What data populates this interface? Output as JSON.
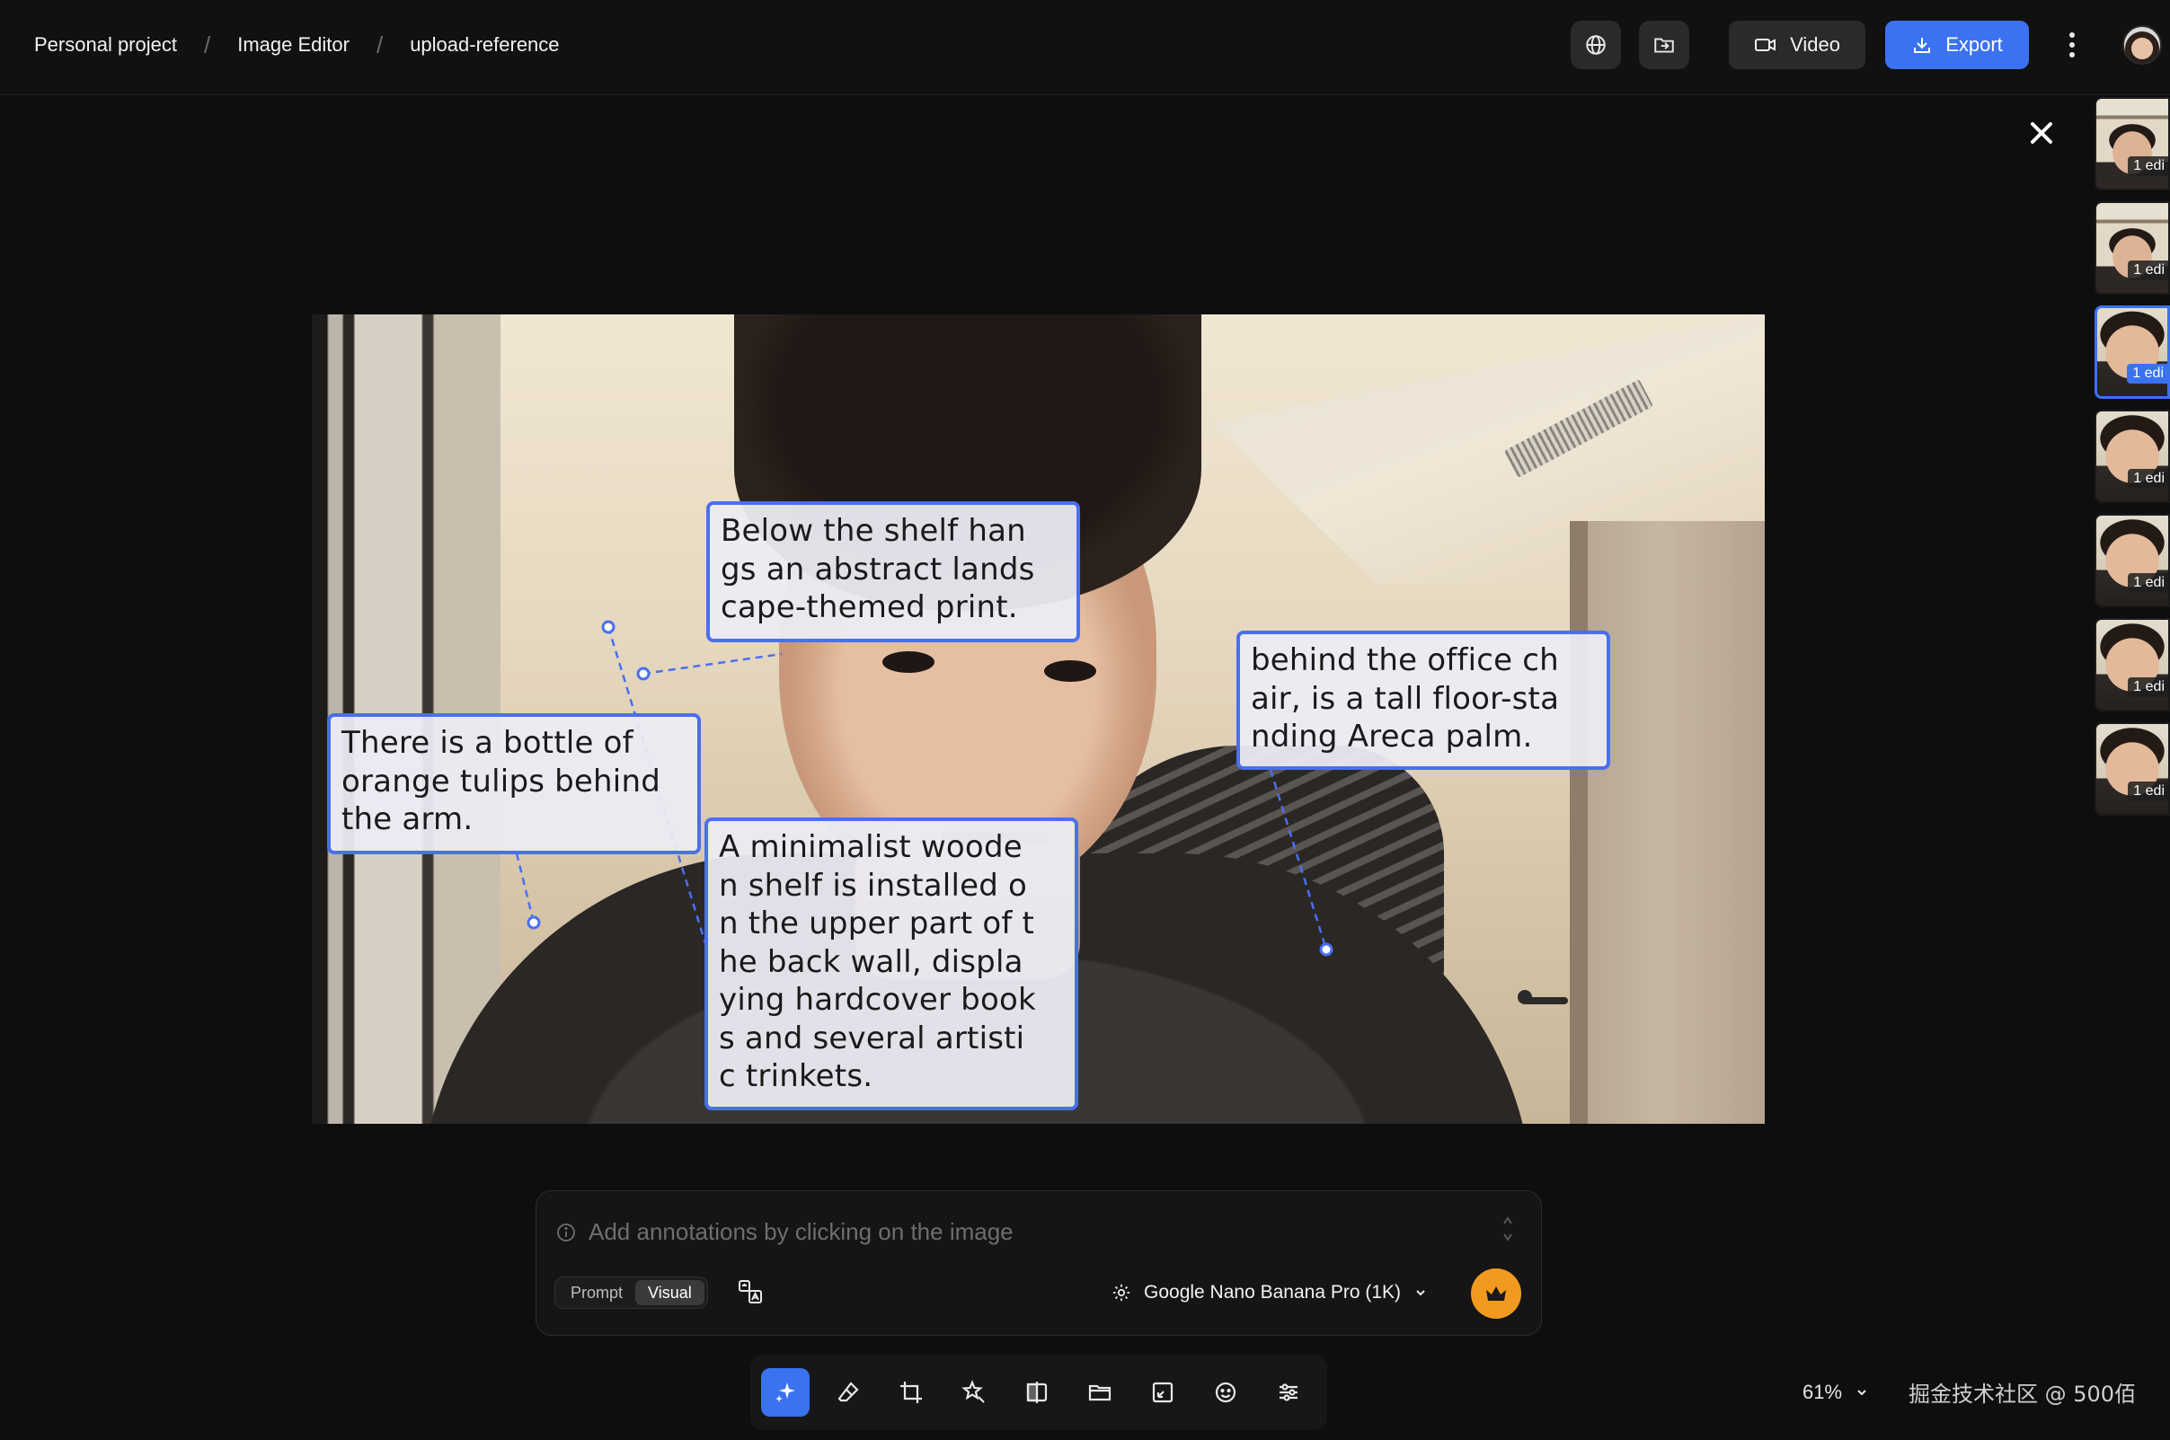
{
  "breadcrumb": [
    "Personal project",
    "Image Editor",
    "upload-reference"
  ],
  "breadcrumb_sep": "/",
  "header": {
    "video_label": "Video",
    "export_label": "Export"
  },
  "thumbnails": [
    {
      "edits": "1 edi",
      "active": false,
      "style": "shelf"
    },
    {
      "edits": "1 edi",
      "active": false,
      "style": "shelf"
    },
    {
      "edits": "1 edi",
      "active": true,
      "style": "face"
    },
    {
      "edits": "1 edi",
      "active": false,
      "style": "face"
    },
    {
      "edits": "1 edi",
      "active": false,
      "style": "face"
    },
    {
      "edits": "1 edi",
      "active": false,
      "style": "face"
    },
    {
      "edits": "1 edi",
      "active": false,
      "style": "face"
    }
  ],
  "annotations": [
    {
      "id": "shelf-print",
      "text": "Below the shelf han\ngs an abstract lands\ncape-themed print."
    },
    {
      "id": "tulips",
      "text": "There is a bottle of\norange tulips behind\n the arm."
    },
    {
      "id": "wooden-shelf",
      "text": "A minimalist woode\nn shelf is installed o\nn the upper part of t\nhe back wall, displa\nying hardcover book\ns and several artisti\nc trinkets."
    },
    {
      "id": "palm",
      "text": "behind the office ch\nair, is a tall floor-sta\nnding Areca palm."
    }
  ],
  "prompt": {
    "placeholder": "Add annotations by clicking on the image",
    "mode_prompt": "Prompt",
    "mode_visual": "Visual",
    "active_mode": "Visual",
    "model": "Google Nano Banana Pro (1K)"
  },
  "tools": [
    "sparkle-icon",
    "eraser-icon",
    "crop-icon",
    "magic-star-icon",
    "compare-icon",
    "folder-icon",
    "resize-icon",
    "face-icon",
    "sliders-icon"
  ],
  "zoom": "61%",
  "watermark": "掘金技术社区 @ 500佰",
  "colors": {
    "accent": "#3a72f0",
    "annotation_border": "#4a6ff0",
    "crown": "#f29a1f"
  }
}
